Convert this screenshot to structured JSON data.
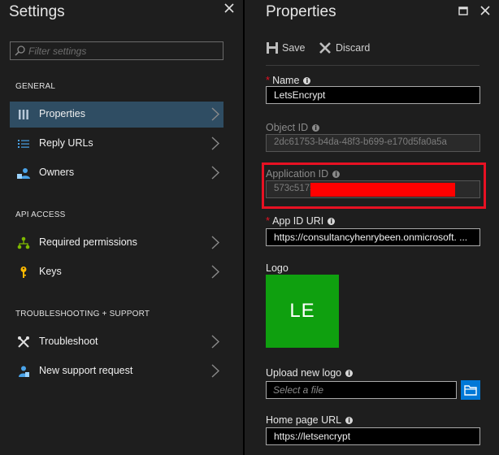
{
  "settings": {
    "title": "Settings",
    "filter_placeholder": "Filter settings",
    "sections": [
      {
        "header": "GENERAL",
        "items": [
          {
            "label": "Properties",
            "icon": "properties-icon",
            "active": true
          },
          {
            "label": "Reply URLs",
            "icon": "reply-urls-icon"
          },
          {
            "label": "Owners",
            "icon": "owners-icon"
          }
        ]
      },
      {
        "header": "API ACCESS",
        "items": [
          {
            "label": "Required permissions",
            "icon": "permissions-icon"
          },
          {
            "label": "Keys",
            "icon": "key-icon"
          }
        ]
      },
      {
        "header": "TROUBLESHOOTING + SUPPORT",
        "items": [
          {
            "label": "Troubleshoot",
            "icon": "troubleshoot-icon"
          },
          {
            "label": "New support request",
            "icon": "support-request-icon"
          }
        ]
      }
    ]
  },
  "properties": {
    "title": "Properties",
    "toolbar": {
      "save": "Save",
      "discard": "Discard"
    },
    "fields": {
      "name": {
        "label": "Name",
        "required": true,
        "value": "LetsEncrypt"
      },
      "object_id": {
        "label": "Object ID",
        "value": "2dc61753-b4da-48f3-b699-e170d5fa0a5a"
      },
      "application_id": {
        "label": "Application ID",
        "value": "573c5175"
      },
      "app_id_uri": {
        "label": "App ID URI",
        "required": true,
        "value": "https://consultancyhenrybeen.onmicrosoft. ..."
      },
      "logo": {
        "label": "Logo",
        "initials": "LE",
        "color": "#0fa00f"
      },
      "upload_logo": {
        "label": "Upload new logo",
        "placeholder": "Select a file"
      },
      "home_page_url": {
        "label": "Home page URL",
        "value": "https://letsencrypt"
      }
    }
  },
  "colors": {
    "accent": "#0078d7",
    "highlight": "#e81123",
    "active_item": "#2f4d63",
    "required": "#e81123"
  }
}
